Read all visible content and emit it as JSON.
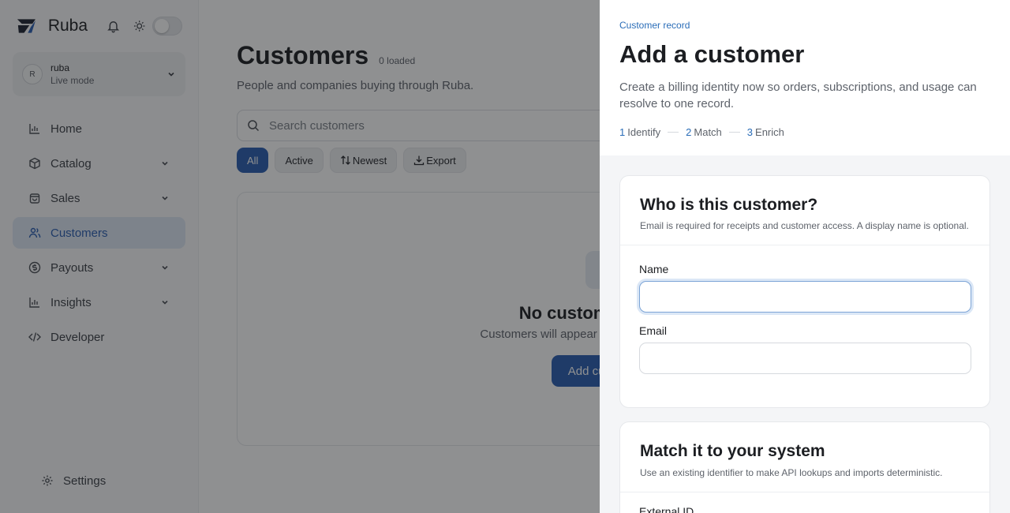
{
  "app": {
    "brand": "Ruba",
    "account": {
      "initial": "R",
      "name": "ruba",
      "mode": "Live mode"
    },
    "nav": [
      {
        "label": "Home",
        "icon": "bar-chart-icon",
        "expandable": false
      },
      {
        "label": "Catalog",
        "icon": "box-icon",
        "expandable": true
      },
      {
        "label": "Sales",
        "icon": "bag-icon",
        "expandable": true
      },
      {
        "label": "Customers",
        "icon": "users-icon",
        "expandable": false,
        "active": true
      },
      {
        "label": "Payouts",
        "icon": "dollar-circle-icon",
        "expandable": true
      },
      {
        "label": "Insights",
        "icon": "bar-chart-icon",
        "expandable": true
      },
      {
        "label": "Developer",
        "icon": "code-icon",
        "expandable": false
      }
    ],
    "settings_label": "Settings"
  },
  "main": {
    "title": "Customers",
    "loaded": "0 loaded",
    "subtitle": "People and companies buying through Ruba.",
    "search_placeholder": "Search customers",
    "filters": {
      "all": "All",
      "active": "Active",
      "newest": "Newest",
      "export": "Export"
    },
    "empty": {
      "title": "No customers yet",
      "subtitle": "Customers will appear here once they buy.",
      "button": "Add customer"
    }
  },
  "drawer": {
    "eyebrow": "Customer record",
    "title": "Add a customer",
    "description": "Create a billing identity now so orders, subscriptions, and usage can resolve to one record.",
    "steps": [
      {
        "num": "1",
        "label": "Identify"
      },
      {
        "num": "2",
        "label": "Match"
      },
      {
        "num": "3",
        "label": "Enrich"
      }
    ],
    "identify": {
      "title": "Who is this customer?",
      "description": "Email is required for receipts and customer access. A display name is optional.",
      "name_label": "Name",
      "name_value": "",
      "email_label": "Email",
      "email_value": ""
    },
    "match": {
      "title": "Match it to your system",
      "description": "Use an existing identifier to make API lookups and imports deterministic.",
      "field_label": "External ID"
    }
  },
  "colors": {
    "accent": "#2a5db0",
    "link": "#2a6db8",
    "overlay": "rgba(20,22,26,0.48)"
  }
}
